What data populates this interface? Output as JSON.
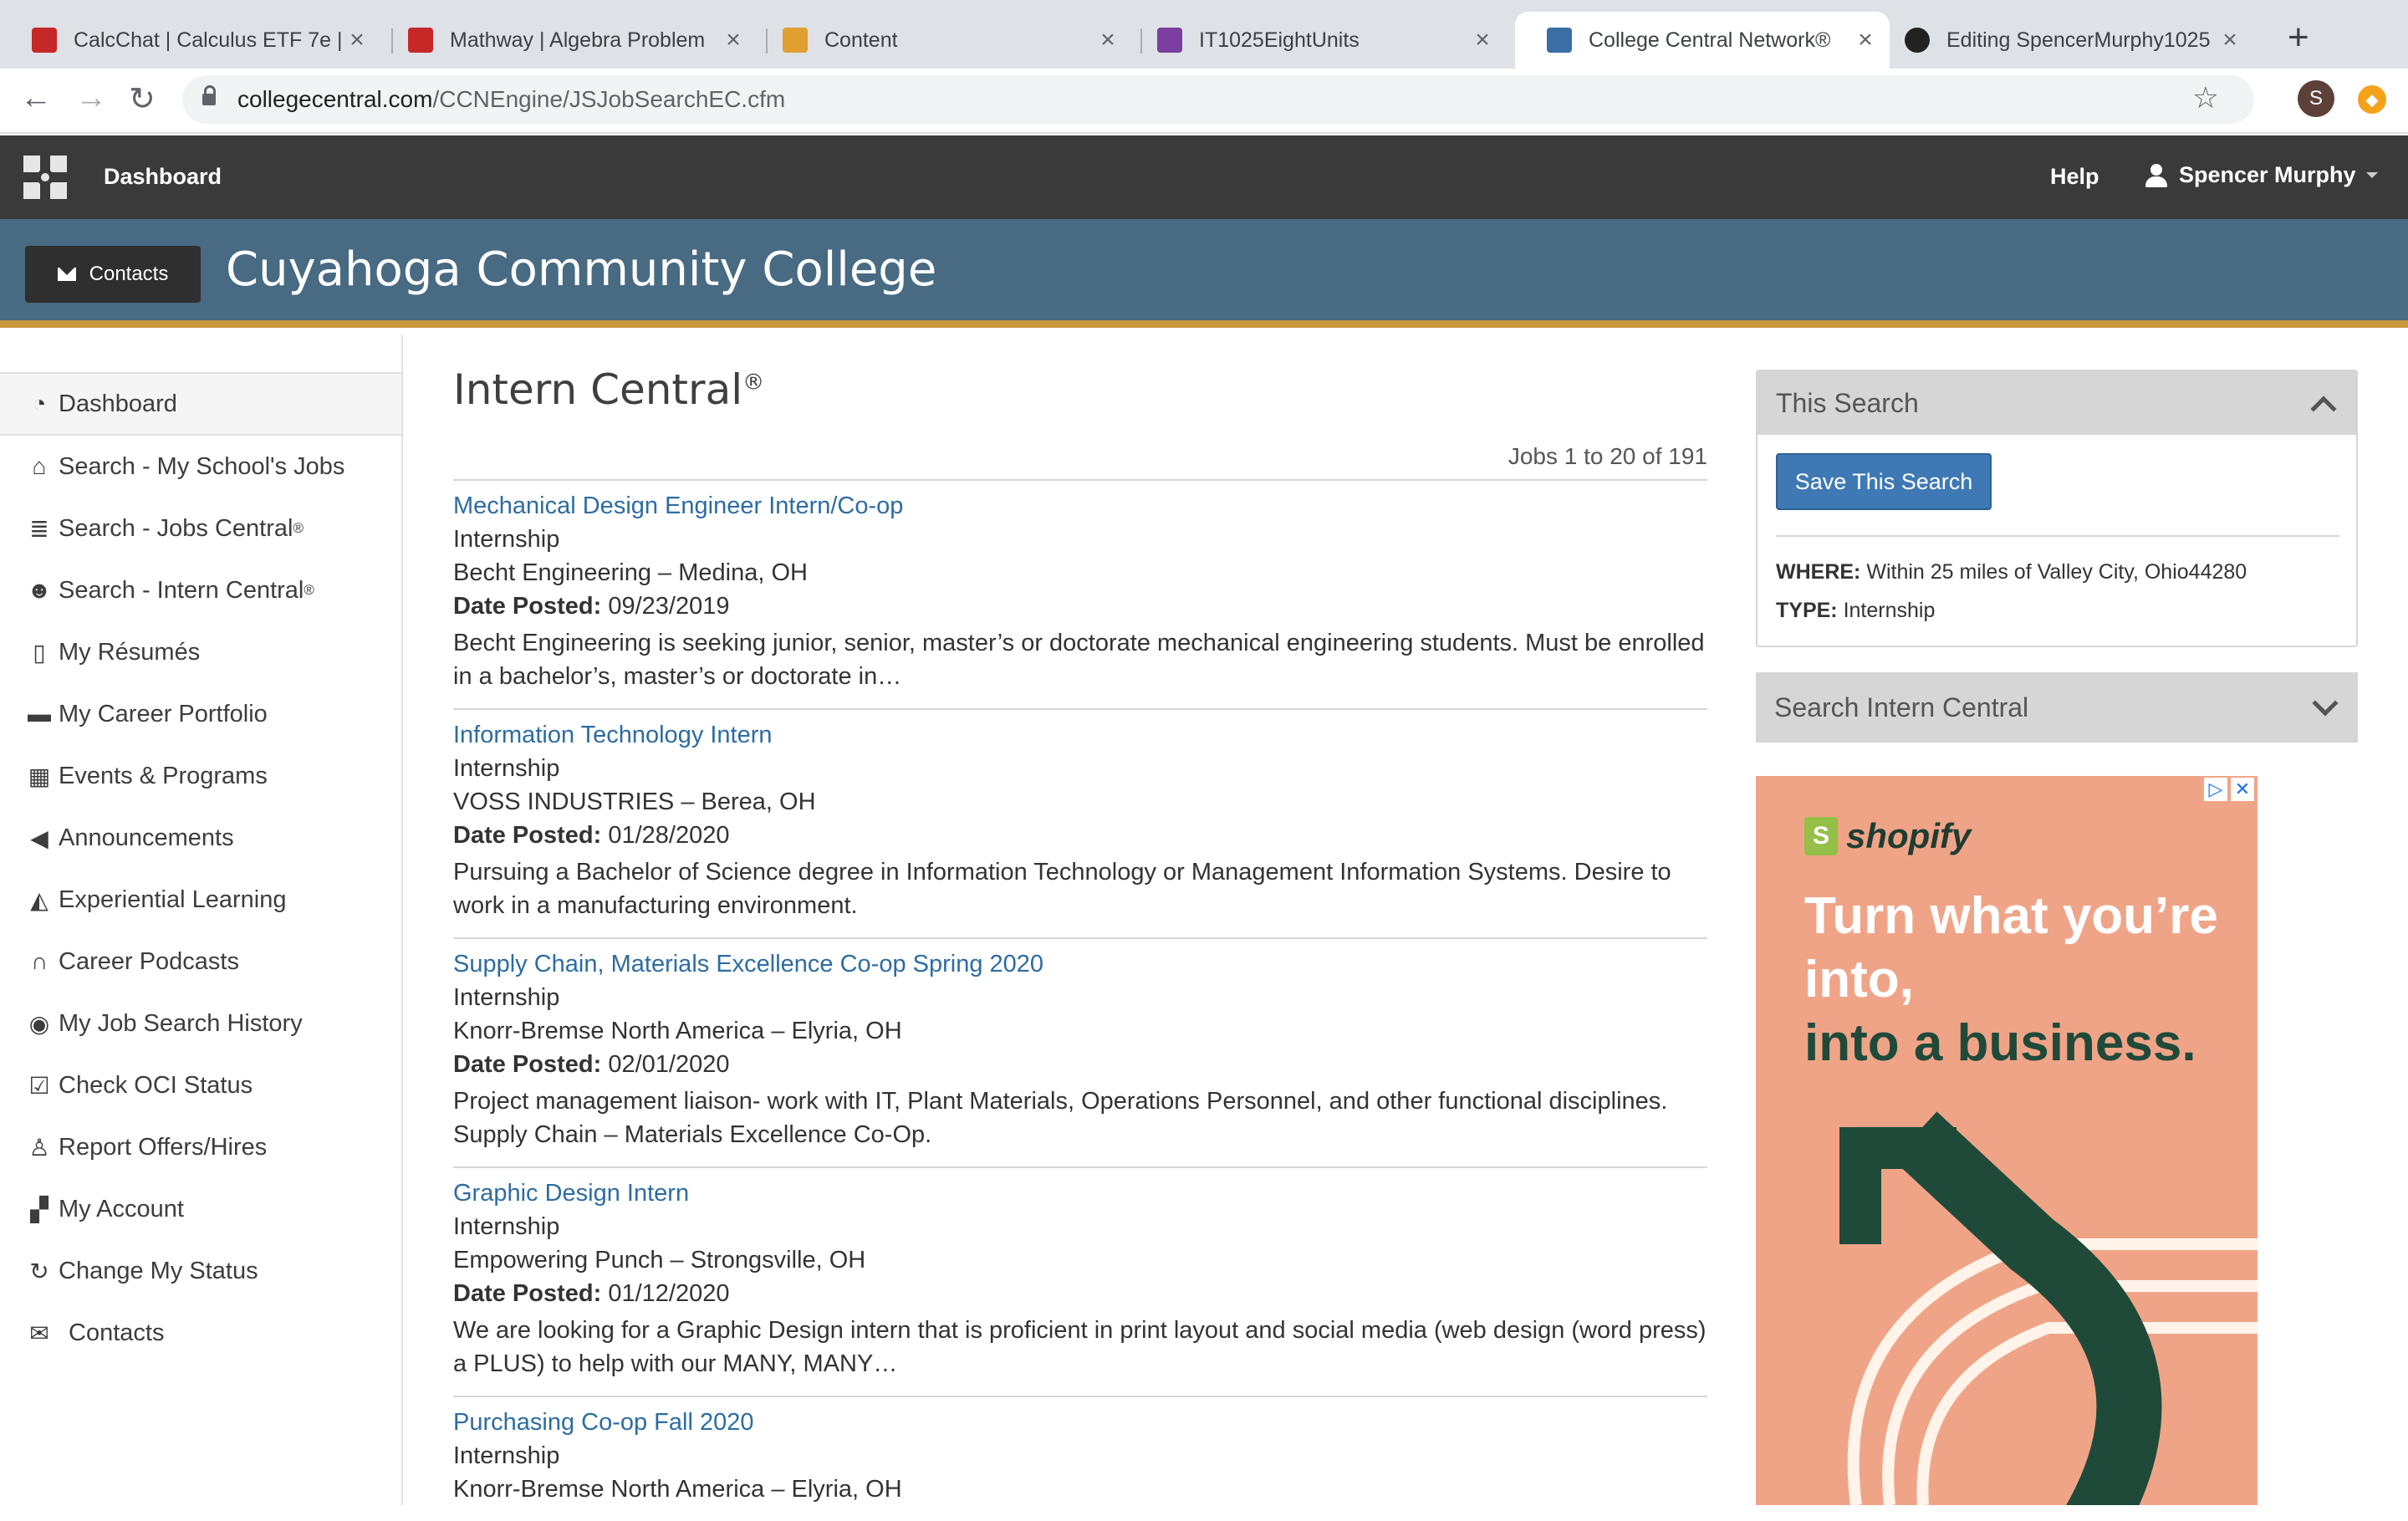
{
  "browser": {
    "tabs": [
      {
        "title": "CalcChat | Calculus ETF 7e |",
        "favicon_color": "#c62828"
      },
      {
        "title": "Mathway | Algebra Problem",
        "favicon_color": "#c62828"
      },
      {
        "title": "Content",
        "favicon_color": "#e0a030"
      },
      {
        "title": "IT1025EightUnits",
        "favicon_color": "#7b3fa0"
      },
      {
        "title": "College Central Network®",
        "favicon_color": "#3a6ea5"
      },
      {
        "title": "Editing SpencerMurphy1025",
        "favicon_color": "#222222"
      }
    ],
    "active_tab_index": 4,
    "url_host": "collegecentral.com",
    "url_path": "/CCNEngine/JSJobSearchEC.cfm",
    "profile_initial": "S"
  },
  "topnav": {
    "dashboard": "Dashboard",
    "help": "Help",
    "user": "Spencer Murphy"
  },
  "banner": {
    "contacts_button": "Contacts",
    "college_name": "Cuyahoga Community College"
  },
  "sidebar": {
    "items": [
      {
        "label": "Dashboard",
        "icon": "gauge-icon"
      },
      {
        "label": "Search - My School's Jobs",
        "icon": "institution-icon"
      },
      {
        "label": "Search - Jobs Central",
        "sup": "®",
        "icon": "stack-icon"
      },
      {
        "label": "Search - Intern Central",
        "sup": "®",
        "icon": "users-icon"
      },
      {
        "label": "My Résumés",
        "icon": "document-icon"
      },
      {
        "label": "My Career Portfolio",
        "icon": "briefcase-icon"
      },
      {
        "label": "Events & Programs",
        "icon": "calendar-icon"
      },
      {
        "label": "Announcements",
        "icon": "bullhorn-icon"
      },
      {
        "label": "Experiential Learning",
        "icon": "graduation-cap-icon"
      },
      {
        "label": "Career Podcasts",
        "icon": "headphones-icon"
      },
      {
        "label": "My Job Search History",
        "icon": "eye-icon"
      },
      {
        "label": "Check OCI Status",
        "icon": "check-square-icon"
      },
      {
        "label": "Report Offers/Hires",
        "icon": "thumbs-up-icon"
      },
      {
        "label": "My Account",
        "icon": "puzzle-icon"
      },
      {
        "label": "Change My Status",
        "icon": "refresh-icon"
      },
      {
        "label": "Contacts",
        "icon": "envelope-icon"
      }
    ]
  },
  "main": {
    "title": "Intern Central",
    "title_sup": "®",
    "count": "Jobs 1 to 20 of 191",
    "date_label": "Date Posted:",
    "jobs": [
      {
        "title": "Mechanical Design Engineer Intern/Co-op",
        "type": "Internship",
        "company": "Becht Engineering – Medina, OH",
        "date": "09/23/2019",
        "desc": "Becht Engineering is seeking junior, senior, master’s or doctorate mechanical engineering students. Must be enrolled in a bachelor’s, master’s or doctorate in…"
      },
      {
        "title": "Information Technology Intern",
        "type": "Internship",
        "company": "VOSS INDUSTRIES – Berea, OH",
        "date": "01/28/2020",
        "desc": "Pursuing a Bachelor of Science degree in Information Technology or Management Information Systems. Desire to work in a manufacturing environment."
      },
      {
        "title": "Supply Chain, Materials Excellence Co-op Spring 2020",
        "type": "Internship",
        "company": "Knorr-Bremse North America – Elyria, OH",
        "date": "02/01/2020",
        "desc": "Project management liaison- work with IT, Plant Materials, Operations Personnel, and other functional disciplines. Supply Chain – Materials Excellence Co-Op."
      },
      {
        "title": "Graphic Design Intern",
        "type": "Internship",
        "company": "Empowering Punch – Strongsville, OH",
        "date": "01/12/2020",
        "desc": "We are looking for a Graphic Design intern that is proficient in print layout and social media (web design (word press) a PLUS) to help with our MANY, MANY…"
      },
      {
        "title": "Purchasing Co-op Fall 2020",
        "type": "Internship",
        "company": "Knorr-Bremse North America – Elyria, OH",
        "date": "",
        "desc": ""
      }
    ]
  },
  "right": {
    "this_search": {
      "title": "This Search",
      "save_button": "Save This Search",
      "where_label": "WHERE:",
      "where_value": "Within 25 miles of Valley City, Ohio44280",
      "type_label": "TYPE:",
      "type_value": "Internship"
    },
    "search_intern_central": {
      "title": "Search Intern Central"
    },
    "ad": {
      "brand": "shopify",
      "line1": "Turn what you’re into,",
      "line2": "into a business."
    }
  }
}
